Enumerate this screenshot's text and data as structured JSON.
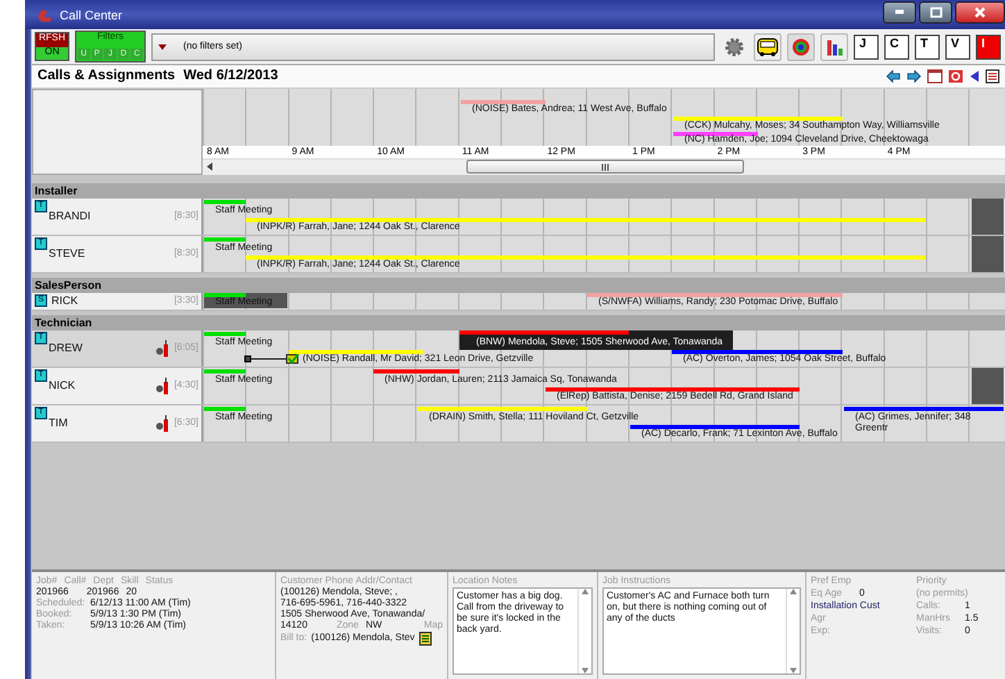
{
  "window": {
    "title": "Call Center"
  },
  "toolbar": {
    "refresh": {
      "label": "RFSH",
      "state": "ON",
      "on": true
    },
    "filters": {
      "label": "Filters",
      "letters": [
        "U",
        "P",
        "J",
        "D",
        "C"
      ]
    },
    "filter_text": "(no filters set)",
    "letter_buttons": [
      {
        "letter": "J",
        "alert": false
      },
      {
        "letter": "C",
        "alert": false
      },
      {
        "letter": "T",
        "alert": false
      },
      {
        "letter": "V",
        "alert": false
      },
      {
        "letter": "I",
        "alert": true
      }
    ]
  },
  "header": {
    "title": "Calls & Assignments",
    "date": "Wed 6/12/2013"
  },
  "unassigned": [
    {
      "label": "(NOISE) Bates,  Andrea; 11 West Ave,  Buffalo",
      "color": "#f4a0a0"
    },
    {
      "label": "(CCK) Mulcahy,  Moses; 34 Southampton Way,  Williamsville",
      "color": "#ffff00"
    },
    {
      "label": "(NC) Hamden,  Joe; 1094 Cleveland Drive,  Cheektowaga",
      "color": "#ff40ff"
    }
  ],
  "hours": [
    "8 AM",
    "9 AM",
    "10 AM",
    "11 AM",
    "12 PM",
    "1 PM",
    "2 PM",
    "3 PM",
    "4 PM"
  ],
  "groups": [
    {
      "name": "Installer",
      "people": [
        {
          "name": "BRANDI",
          "shift": "[8:30]",
          "badge": "T",
          "selected": false,
          "tool_icon": false,
          "off_block": true,
          "items": [
            {
              "label": "Staff Meeting",
              "color": "#00e000",
              "kind": "bar"
            },
            {
              "label": "(INPK/R) Farrah,  Jane; 1244 Oak St.,  Clarence",
              "color": "#ffff00",
              "kind": "bar"
            }
          ]
        },
        {
          "name": "STEVE",
          "shift": "[8:30]",
          "badge": "T",
          "selected": false,
          "tool_icon": false,
          "off_block": true,
          "items": [
            {
              "label": "Staff Meeting",
              "color": "#00e000",
              "kind": "bar"
            },
            {
              "label": "(INPK/R) Farrah,  Jane; 1244 Oak St.,  Clarence",
              "color": "#ffff00",
              "kind": "bar"
            }
          ]
        }
      ]
    },
    {
      "name": "SalesPerson",
      "people": [
        {
          "name": "RICK",
          "shift": "[3:30]",
          "badge": "S",
          "selected": false,
          "tool_icon": false,
          "off_block": false,
          "items": [
            {
              "label": "Staff Meeting",
              "color": "#00e000",
              "kind": "shaded"
            },
            {
              "label": "(S/NWFA) Williams,  Randy; 230 Potomac Drive,  Buffalo",
              "color": "#f4a0a0",
              "kind": "bar"
            }
          ]
        }
      ]
    },
    {
      "name": "Technician",
      "people": [
        {
          "name": "DREW",
          "shift": "[6:05]",
          "badge": "T",
          "selected": true,
          "tool_icon": true,
          "off_block": false,
          "items": [
            {
              "label": "Staff Meeting",
              "color": "#00e000",
              "kind": "bar"
            },
            {
              "label": "(NOISE) Randall,  Mr David; 321 Leon Drive,  Getzville",
              "color": "#ffff00",
              "kind": "linked"
            },
            {
              "label": "(BNW) Mendola,  Steve; 1505 Sherwood Ave,  Tonawanda",
              "color": "#ff0000",
              "kind": "dark"
            },
            {
              "label": "(AC) Overton,  James; 1054 Oak Street,  Buffalo",
              "color": "#0000ff",
              "kind": "bar"
            }
          ]
        },
        {
          "name": "NICK",
          "shift": "[4:30]",
          "badge": "T",
          "selected": false,
          "tool_icon": true,
          "off_block": true,
          "items": [
            {
              "label": "Staff Meeting",
              "color": "#00e000",
              "kind": "bar"
            },
            {
              "label": "(NHW) Jordan,  Lauren; 2113 Jamaica Sq,  Tonawanda",
              "color": "#ff0000",
              "kind": "bar"
            },
            {
              "label": "(ElRep) Battista,  Denise; 2159 Bedell Rd,  Grand Island",
              "color": "#ff0000",
              "kind": "bar"
            }
          ]
        },
        {
          "name": "TIM",
          "shift": "[6:30]",
          "badge": "T",
          "selected": false,
          "tool_icon": true,
          "off_block": false,
          "items": [
            {
              "label": "Staff Meeting",
              "color": "#00e000",
              "kind": "bar"
            },
            {
              "label": "(DRAIN) Smith,  Stella; 111 Hoviland Ct,  Getzville",
              "color": "#ffff00",
              "kind": "bar"
            },
            {
              "label": "(AC) Decarlo,  Frank; 71 Lexinton Ave,  Buffalo",
              "color": "#0000ff",
              "kind": "bar"
            },
            {
              "label": "(AC) Grimes,  Jennifer; 348 Greentr",
              "color": "#0000ff",
              "kind": "bar"
            }
          ]
        }
      ]
    }
  ],
  "details": {
    "job_headers": [
      "Job#",
      "Call#",
      "Dept",
      "Skill",
      "Status"
    ],
    "job_values": [
      "201966",
      "201966",
      "20"
    ],
    "dates": [
      {
        "label": "Scheduled:",
        "value": "6/12/13 11:00 AM (Tim)"
      },
      {
        "label": "Booked:",
        "value": "5/9/13 1:30 PM (Tim)"
      },
      {
        "label": "Taken:",
        "value": "5/9/13 10:26 AM (Tim)"
      }
    ],
    "customer_header": "Customer Phone Addr/Contact",
    "customer_lines": [
      "(100126) Mendola,  Steve; ,",
      "716-695-5961, 716-440-3322",
      "1505 Sherwood Ave,  Tonawanda/"
    ],
    "zip": "14120",
    "zone_label": "Zone",
    "zone": "NW",
    "map_label": "Map",
    "bill_label": "Bill to:",
    "bill_to": "(100126) Mendola,  Stev",
    "location_notes": {
      "title": "Location Notes",
      "text": "Customer has a big dog. Call from the driveway to be sure it's locked in the back yard."
    },
    "job_instructions": {
      "title": "Job Instructions",
      "text": "Customer's AC and Furnace both turn on, but there is nothing coming out of any of the ducts"
    },
    "pref": [
      {
        "label": "Pref Emp"
      },
      {
        "label": "Eq Age",
        "value": "0"
      },
      {
        "label": "Installation Cust",
        "kind": "link"
      },
      {
        "label": "Agr"
      },
      {
        "label": "Exp:"
      }
    ],
    "priority": [
      {
        "label": "Priority"
      },
      {
        "label": "(no permits)"
      },
      {
        "label": "Calls:",
        "value": "1"
      },
      {
        "label": "ManHrs",
        "value": "1.5"
      },
      {
        "label": "Visits:",
        "value": "0"
      }
    ]
  }
}
